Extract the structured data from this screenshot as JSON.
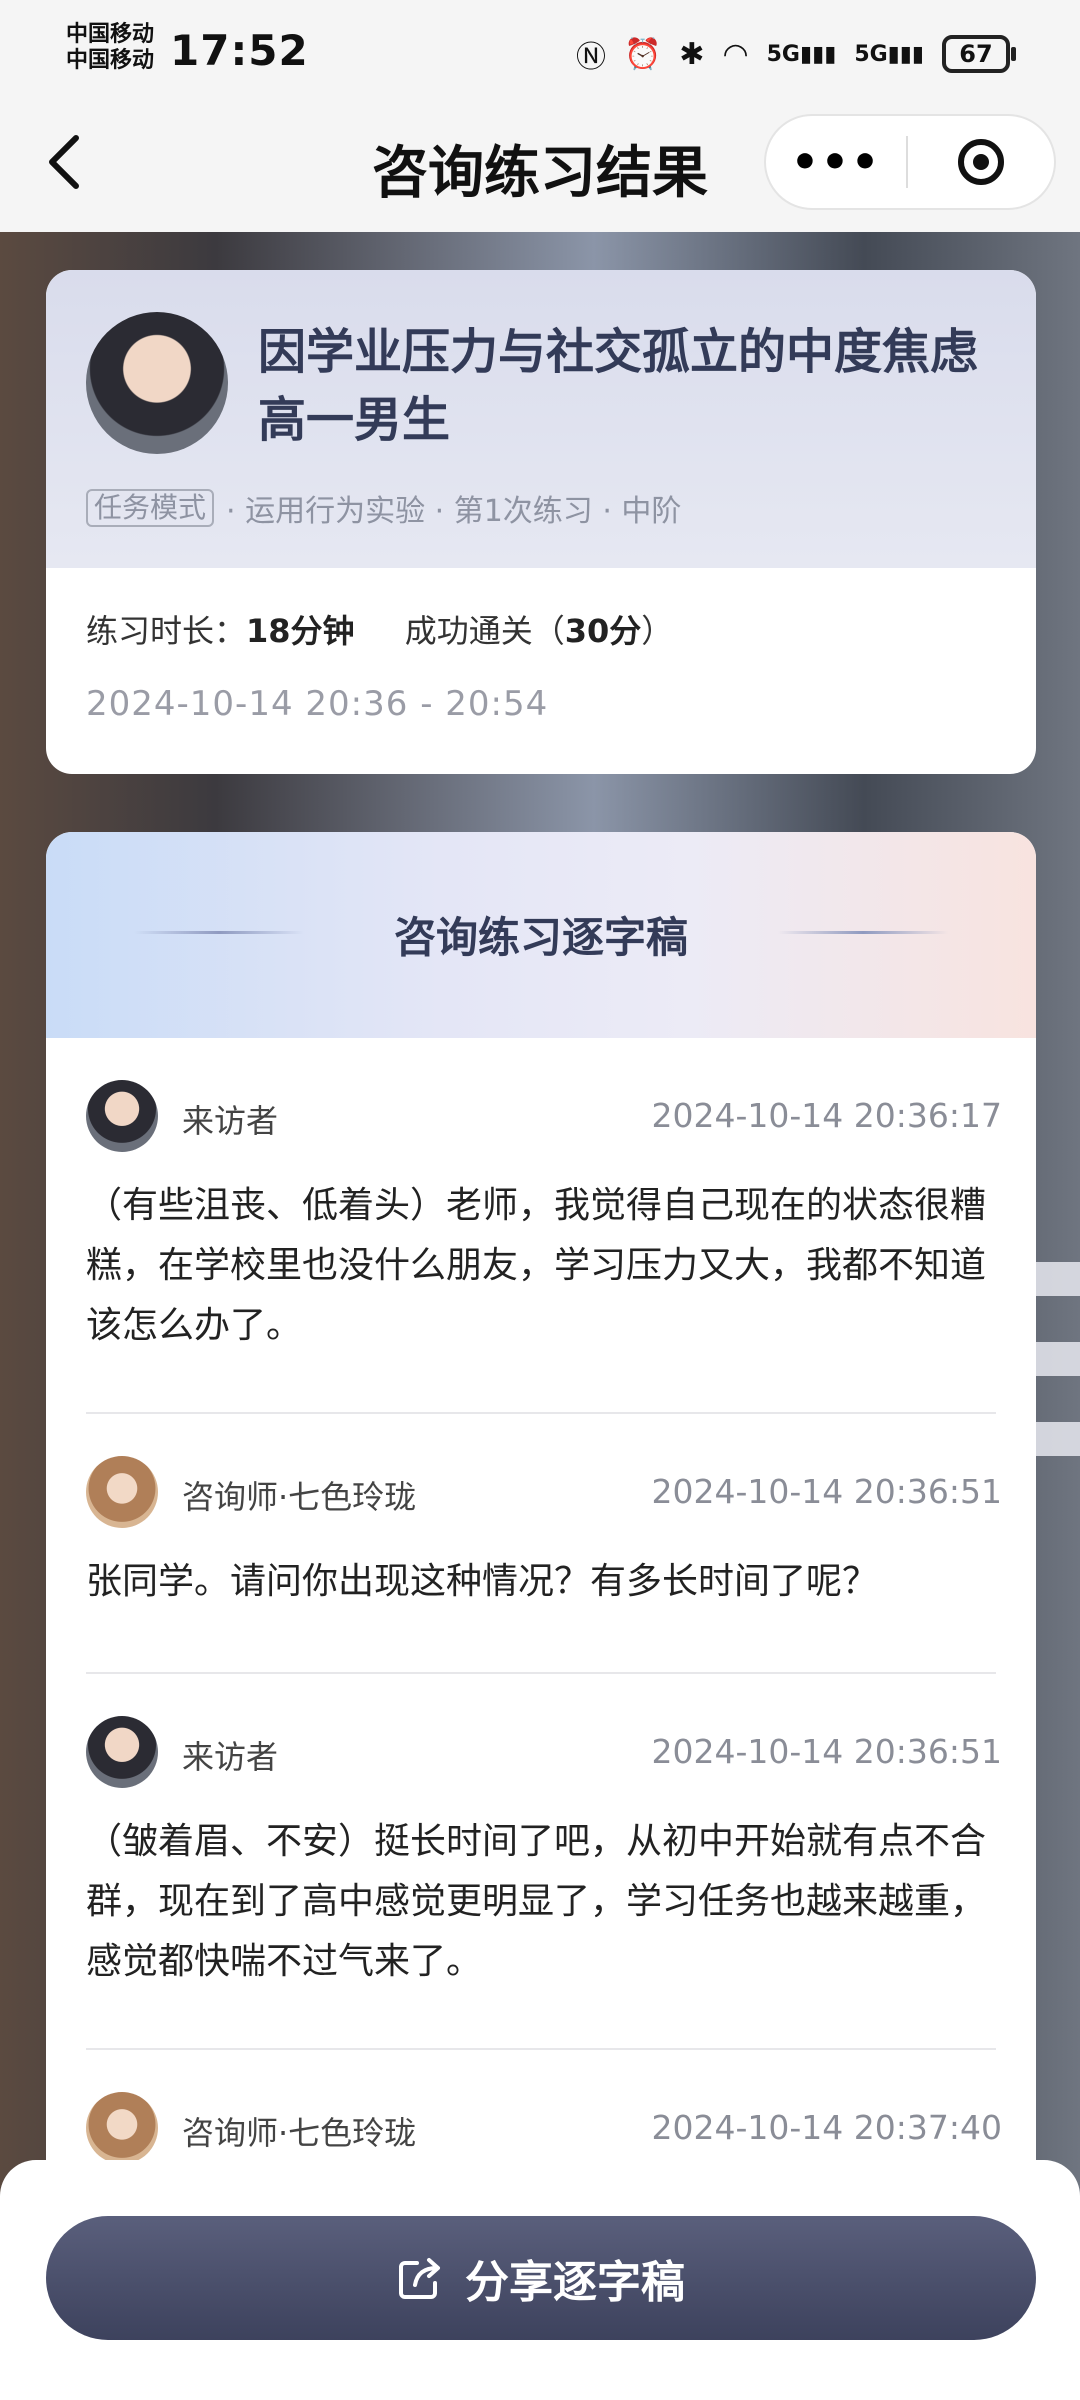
{
  "status": {
    "carrier_line1": "中国移动",
    "carrier_line2": "中国移动",
    "time": "17:52",
    "battery": "67"
  },
  "nav": {
    "title": "咨询练习结果"
  },
  "summary": {
    "title": "因学业压力与社交孤立的中度焦虑高一男生",
    "mode_tag": "任务模式",
    "meta": "· 运用行为实验 · 第1次练习 · 中阶",
    "duration_label": "练习时长：",
    "duration_value": "18分钟",
    "pass_label": "成功通关（",
    "pass_score": "30分",
    "pass_suffix": "）",
    "time_range": "2024-10-14 20:36 - 20:54"
  },
  "transcript": {
    "title": "咨询练习逐字稿",
    "messages": [
      {
        "speaker": "来访者",
        "time": "2024-10-14 20:36:17",
        "text": "（有些沮丧、低着头）老师，我觉得自己现在的状态很糟糕，在学校里也没什么朋友，学习压力又大，我都不知道该怎么办了。"
      },
      {
        "speaker": "咨询师·七色玲珑",
        "time": "2024-10-14 20:36:51",
        "text": "张同学。请问你出现这种情况？有多长时间了呢？"
      },
      {
        "speaker": "来访者",
        "time": "2024-10-14 20:36:51",
        "text": "（皱着眉、不安）挺长时间了吧，从初中开始就有点不合群，现在到了高中感觉更明显了，学习任务也越来越重，感觉都快喘不过气来了。"
      },
      {
        "speaker": "咨询师·七色玲珑",
        "time": "2024-10-14 20:37:40",
        "text": ""
      }
    ]
  },
  "bottom": {
    "share_label": "分享逐字稿"
  },
  "colors": {
    "title_text": "#333b58",
    "button": "#3d425d",
    "meta_text": "#8e93a2"
  },
  "icons": [
    "back-arrow-icon",
    "more-icon",
    "target-icon",
    "share-icon",
    "nfc-icon",
    "alarm-icon",
    "bluetooth-icon",
    "wifi-icon",
    "signal-icon",
    "battery-icon"
  ]
}
